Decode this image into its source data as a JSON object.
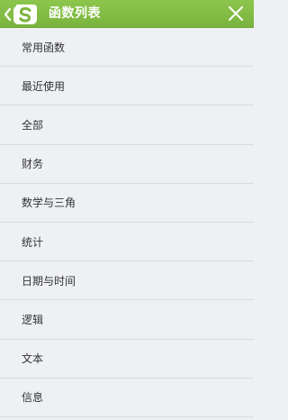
{
  "header": {
    "title": "函数列表",
    "back_icon": "back-logo-icon",
    "close_icon": "close-icon"
  },
  "colors": {
    "header_bg": "#7ab43d",
    "list_bg": "#eef0f3",
    "divider": "#d8dbe0",
    "text": "#333333"
  },
  "list": {
    "items": [
      {
        "label": "常用函数"
      },
      {
        "label": "最近使用"
      },
      {
        "label": "全部"
      },
      {
        "label": "财务"
      },
      {
        "label": "数学与三角"
      },
      {
        "label": "统计"
      },
      {
        "label": "日期与时间"
      },
      {
        "label": "逻辑"
      },
      {
        "label": "文本"
      },
      {
        "label": "信息"
      }
    ]
  }
}
